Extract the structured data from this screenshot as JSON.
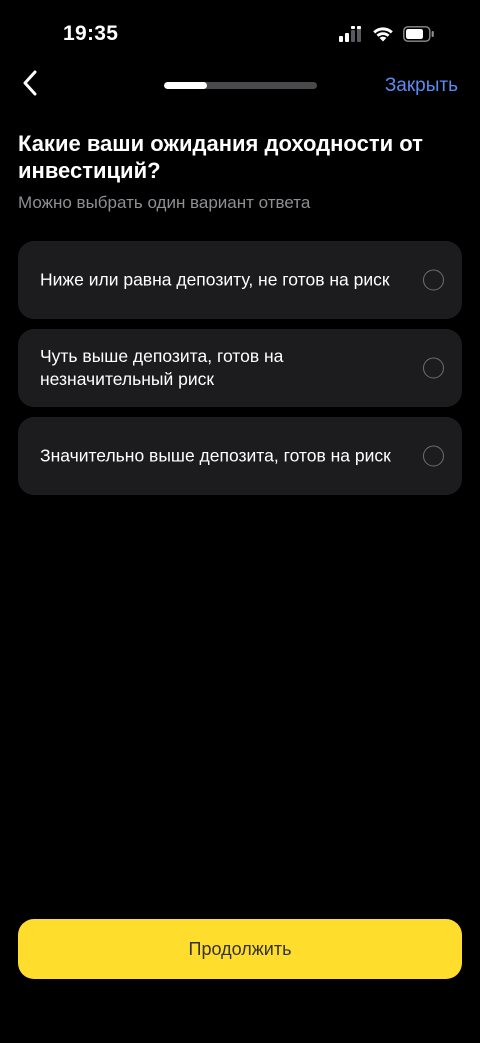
{
  "status_bar": {
    "time": "19:35",
    "icons": [
      "cellular-signal-icon",
      "wifi-icon",
      "battery-icon"
    ]
  },
  "nav": {
    "back_icon": "chevron-left-icon",
    "progress": 0.28,
    "close_label": "Закрыть"
  },
  "question": {
    "title": "Какие ваши ожидания доходности от инвестиций?",
    "subtitle": "Можно выбрать один вариант ответа"
  },
  "options": [
    {
      "label": "Ниже или равна депозиту, не готов на риск",
      "selected": false
    },
    {
      "label": "Чуть выше депозита, готов на незначительный риск",
      "selected": false
    },
    {
      "label": "Значительно выше депозита, готов на риск",
      "selected": false
    }
  ],
  "footer": {
    "continue_label": "Продолжить"
  },
  "colors": {
    "background": "#000000",
    "card": "#1c1c1e",
    "accent_button": "#ffdd2d",
    "link": "#5b8bf0",
    "secondary_text": "#8e8e93"
  }
}
